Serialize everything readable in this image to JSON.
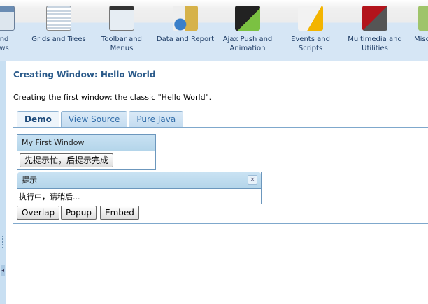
{
  "categories": [
    {
      "label": "and\nows",
      "icon": "windows-icon"
    },
    {
      "label": "Grids and Trees",
      "icon": "grid-icon"
    },
    {
      "label": "Toolbar and\nMenus",
      "icon": "toolbar-icon"
    },
    {
      "label": "Data and Report",
      "icon": "database-icon"
    },
    {
      "label": "Ajax Push and\nAnimation",
      "icon": "clapperboard-icon"
    },
    {
      "label": "Events and Scripts",
      "icon": "script-icon"
    },
    {
      "label": "Multimedia and\nUtilities",
      "icon": "multimedia-icon"
    },
    {
      "label": "Misc",
      "icon": "misc-icon"
    }
  ],
  "title": "Creating Window: Hello World",
  "description": "Creating the first window: the classic \"Hello World\".",
  "tabs": [
    "Demo",
    "View Source",
    "Pure Java"
  ],
  "window1": {
    "title": "My First Window",
    "button": "先提示忙，后提示完成"
  },
  "window2": {
    "title": "提示",
    "message": "执行中，请稍后...",
    "close": "×"
  },
  "buttons": {
    "overlap": "Overlap",
    "popup": "Popup",
    "embed": "Embed"
  }
}
